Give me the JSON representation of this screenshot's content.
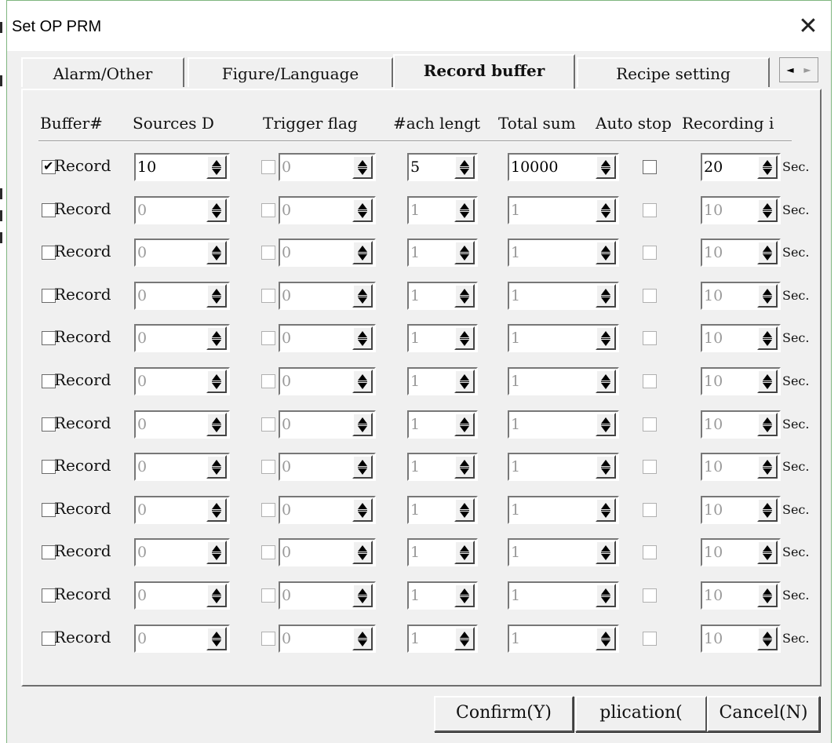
{
  "window": {
    "title": "Set OP PRM"
  },
  "tabs": [
    {
      "label": "Alarm/Other",
      "active": false
    },
    {
      "label": "Figure/Language",
      "active": false
    },
    {
      "label": "Record buffer",
      "active": true
    },
    {
      "label": "Recipe setting",
      "active": false
    }
  ],
  "tab_scroll": {
    "left": "◄",
    "right": "►"
  },
  "header": {
    "buffer": "Buffer#",
    "sources": "Sources D",
    "trigger": "Trigger flag",
    "each_length": "#ach lengt",
    "total_sum": "Total sum",
    "auto_stop": "Auto stop",
    "recording": "Recording i"
  },
  "record_label": "Record",
  "unit_label": "Sec.",
  "rows": [
    {
      "record": true,
      "sources": "10",
      "trigger_checked": false,
      "trigger_value": "0",
      "each_length": "5",
      "total_sum": "10000",
      "auto_stop": false,
      "interval": "20",
      "enabled": true
    },
    {
      "record": false,
      "sources": "0",
      "trigger_checked": false,
      "trigger_value": "0",
      "each_length": "1",
      "total_sum": "1",
      "auto_stop": false,
      "interval": "10",
      "enabled": false
    },
    {
      "record": false,
      "sources": "0",
      "trigger_checked": false,
      "trigger_value": "0",
      "each_length": "1",
      "total_sum": "1",
      "auto_stop": false,
      "interval": "10",
      "enabled": false
    },
    {
      "record": false,
      "sources": "0",
      "trigger_checked": false,
      "trigger_value": "0",
      "each_length": "1",
      "total_sum": "1",
      "auto_stop": false,
      "interval": "10",
      "enabled": false
    },
    {
      "record": false,
      "sources": "0",
      "trigger_checked": false,
      "trigger_value": "0",
      "each_length": "1",
      "total_sum": "1",
      "auto_stop": false,
      "interval": "10",
      "enabled": false
    },
    {
      "record": false,
      "sources": "0",
      "trigger_checked": false,
      "trigger_value": "0",
      "each_length": "1",
      "total_sum": "1",
      "auto_stop": false,
      "interval": "10",
      "enabled": false
    },
    {
      "record": false,
      "sources": "0",
      "trigger_checked": false,
      "trigger_value": "0",
      "each_length": "1",
      "total_sum": "1",
      "auto_stop": false,
      "interval": "10",
      "enabled": false
    },
    {
      "record": false,
      "sources": "0",
      "trigger_checked": false,
      "trigger_value": "0",
      "each_length": "1",
      "total_sum": "1",
      "auto_stop": false,
      "interval": "10",
      "enabled": false
    },
    {
      "record": false,
      "sources": "0",
      "trigger_checked": false,
      "trigger_value": "0",
      "each_length": "1",
      "total_sum": "1",
      "auto_stop": false,
      "interval": "10",
      "enabled": false
    },
    {
      "record": false,
      "sources": "0",
      "trigger_checked": false,
      "trigger_value": "0",
      "each_length": "1",
      "total_sum": "1",
      "auto_stop": false,
      "interval": "10",
      "enabled": false
    },
    {
      "record": false,
      "sources": "0",
      "trigger_checked": false,
      "trigger_value": "0",
      "each_length": "1",
      "total_sum": "1",
      "auto_stop": false,
      "interval": "10",
      "enabled": false
    },
    {
      "record": false,
      "sources": "0",
      "trigger_checked": false,
      "trigger_value": "0",
      "each_length": "1",
      "total_sum": "1",
      "auto_stop": false,
      "interval": "10",
      "enabled": false
    }
  ],
  "buttons": {
    "confirm": "Confirm(Y)",
    "application": "plication(",
    "cancel": "Cancel(N)"
  }
}
